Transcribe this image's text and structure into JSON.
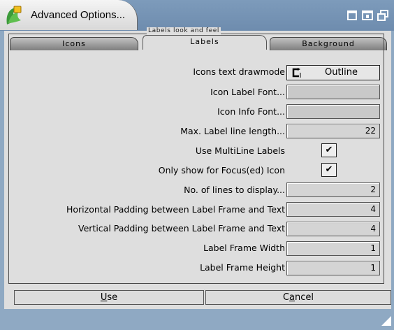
{
  "window": {
    "title": "Advanced Options...",
    "icons": [
      "app-icon",
      "iconify-icon",
      "maximize-icon",
      "restore-icon"
    ]
  },
  "tabs": [
    {
      "label": "Icons",
      "active": false
    },
    {
      "label": "Labels",
      "active": true
    },
    {
      "label": "Background",
      "active": false
    }
  ],
  "group": {
    "title": "Labels look and feel"
  },
  "rows": {
    "drawmode": {
      "label": "Icons text drawmode",
      "value": "Outline"
    },
    "label_font": {
      "label": "Icon Label Font...",
      "value": ""
    },
    "info_font": {
      "label": "Icon Info Font...",
      "value": ""
    },
    "max_line_length": {
      "label": "Max. Label line length...",
      "value": "22"
    },
    "multiline": {
      "label": "Use MultiLine Labels",
      "checked": true,
      "mark": "✔"
    },
    "focus_only": {
      "label": "Only show for Focus(ed) Icon",
      "checked": true,
      "mark": "✔"
    },
    "num_lines": {
      "label": "No. of lines to display...",
      "value": "2"
    },
    "h_padding": {
      "label": "Horizontal Padding between Label Frame and Text",
      "value": "4"
    },
    "v_padding": {
      "label": "Vertical Padding between Label Frame and Text",
      "value": "4"
    },
    "frame_width": {
      "label": "Label Frame Width",
      "value": "1"
    },
    "frame_height": {
      "label": "Label Frame Height",
      "value": "1"
    }
  },
  "buttons": {
    "use": {
      "pre": "",
      "u": "U",
      "post": "se"
    },
    "cancel": {
      "pre": "C",
      "u": "a",
      "post": "ncel"
    }
  }
}
